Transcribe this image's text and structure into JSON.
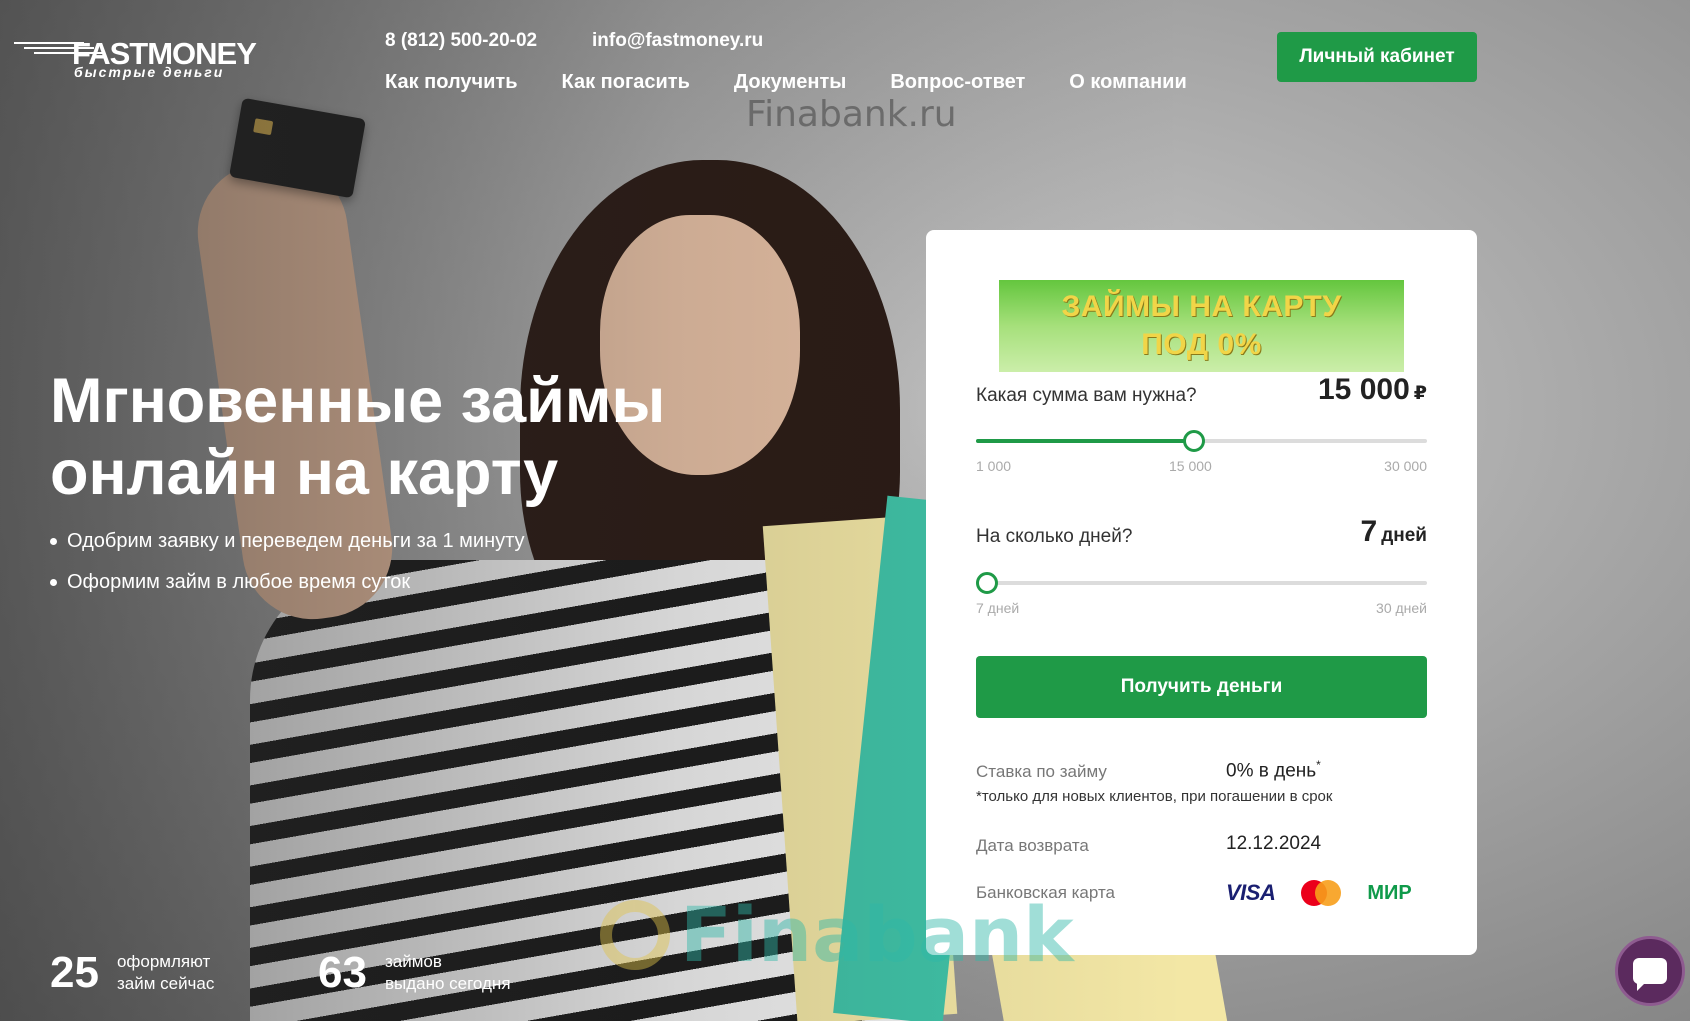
{
  "header": {
    "logo": {
      "name": "FASTMONEY",
      "tagline": "быстрые деньги"
    },
    "phone": "8 (812) 500-20-02",
    "email": "info@fastmoney.ru",
    "nav": [
      "Как получить",
      "Как погасить",
      "Документы",
      "Вопрос-ответ",
      "О компании"
    ],
    "cabinet_label": "Личный кабинет"
  },
  "watermark": {
    "top": "Finabank.ru",
    "bottom": "Finabank"
  },
  "hero": {
    "title_line1": "Мгновенные займы",
    "title_line2": "онлайн на карту",
    "bullets": [
      "Одобрим заявку и переведем деньги за 1 минуту",
      "Оформим займ в любое время суток"
    ]
  },
  "stats": [
    {
      "number": "25",
      "label_line1": "оформляют",
      "label_line2": "займ сейчас"
    },
    {
      "number": "63",
      "label_line1": "займов",
      "label_line2": "выдано сегодня"
    }
  ],
  "calculator": {
    "promo_line1": "ЗАЙМЫ НА КАРТУ",
    "promo_line2": "ПОД 0%",
    "amount": {
      "question": "Какая сумма вам нужна?",
      "value": "15 000",
      "unit": "₽",
      "min_label": "1 000",
      "mid_label": "15 000",
      "max_label": "30 000",
      "fraction": 0.483
    },
    "days": {
      "question": "На сколько дней?",
      "value": "7",
      "unit": "дней",
      "min_label": "7 дней",
      "max_label": "30 дней",
      "fraction": 0
    },
    "submit_label": "Получить деньги",
    "rate_label": "Ставка по займу",
    "rate_value": "0% в день",
    "rate_asterisk": "*",
    "rate_note": "*только для новых клиентов, при погашении в срок",
    "return_label": "Дата возврата",
    "return_value": "12.12.2024",
    "card_label": "Банковская карта",
    "payment_systems": {
      "visa": "VISA",
      "mir": "МИР"
    }
  },
  "colors": {
    "accent": "#1f9a47",
    "chat": "#5b2a5e"
  }
}
